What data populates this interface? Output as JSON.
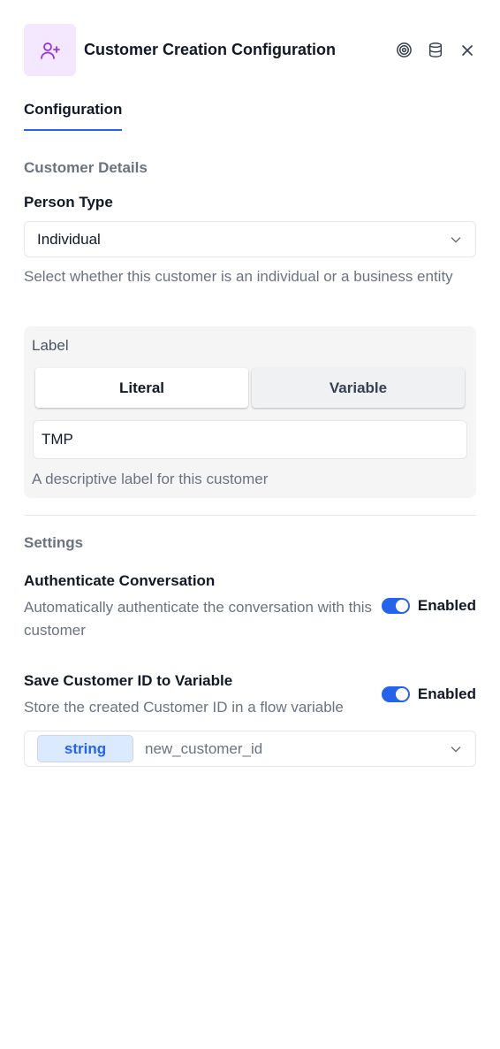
{
  "header": {
    "title": "Customer Creation Configuration",
    "icon": "user-plus-icon",
    "actions": [
      "target-icon",
      "database-icon",
      "close-icon"
    ]
  },
  "tabs": [
    {
      "label": "Configuration",
      "active": true
    }
  ],
  "customer_details": {
    "section_title": "Customer Details",
    "person_type": {
      "label": "Person Type",
      "value": "Individual",
      "help": "Select whether this customer is an individual or a business entity"
    },
    "label_field": {
      "label": "Label",
      "modes": [
        "Literal",
        "Variable"
      ],
      "active_mode": "Literal",
      "value": "TMP",
      "hint": "A descriptive label for this customer"
    }
  },
  "settings": {
    "section_title": "Settings",
    "authenticate": {
      "title": "Authenticate Conversation",
      "description": "Automatically authenticate the conversation with this customer",
      "toggle_label": "Enabled",
      "enabled": true
    },
    "save_id": {
      "title": "Save Customer ID to Variable",
      "description": "Store the created Customer ID in a flow variable",
      "toggle_label": "Enabled",
      "enabled": true,
      "variable_type": "string",
      "variable_name": "new_customer_id"
    }
  },
  "colors": {
    "accent": "#2563eb",
    "icon_tile_bg": "#f3e8ff",
    "icon_color": "#9333ea",
    "pill_bg": "#dbeafe"
  }
}
